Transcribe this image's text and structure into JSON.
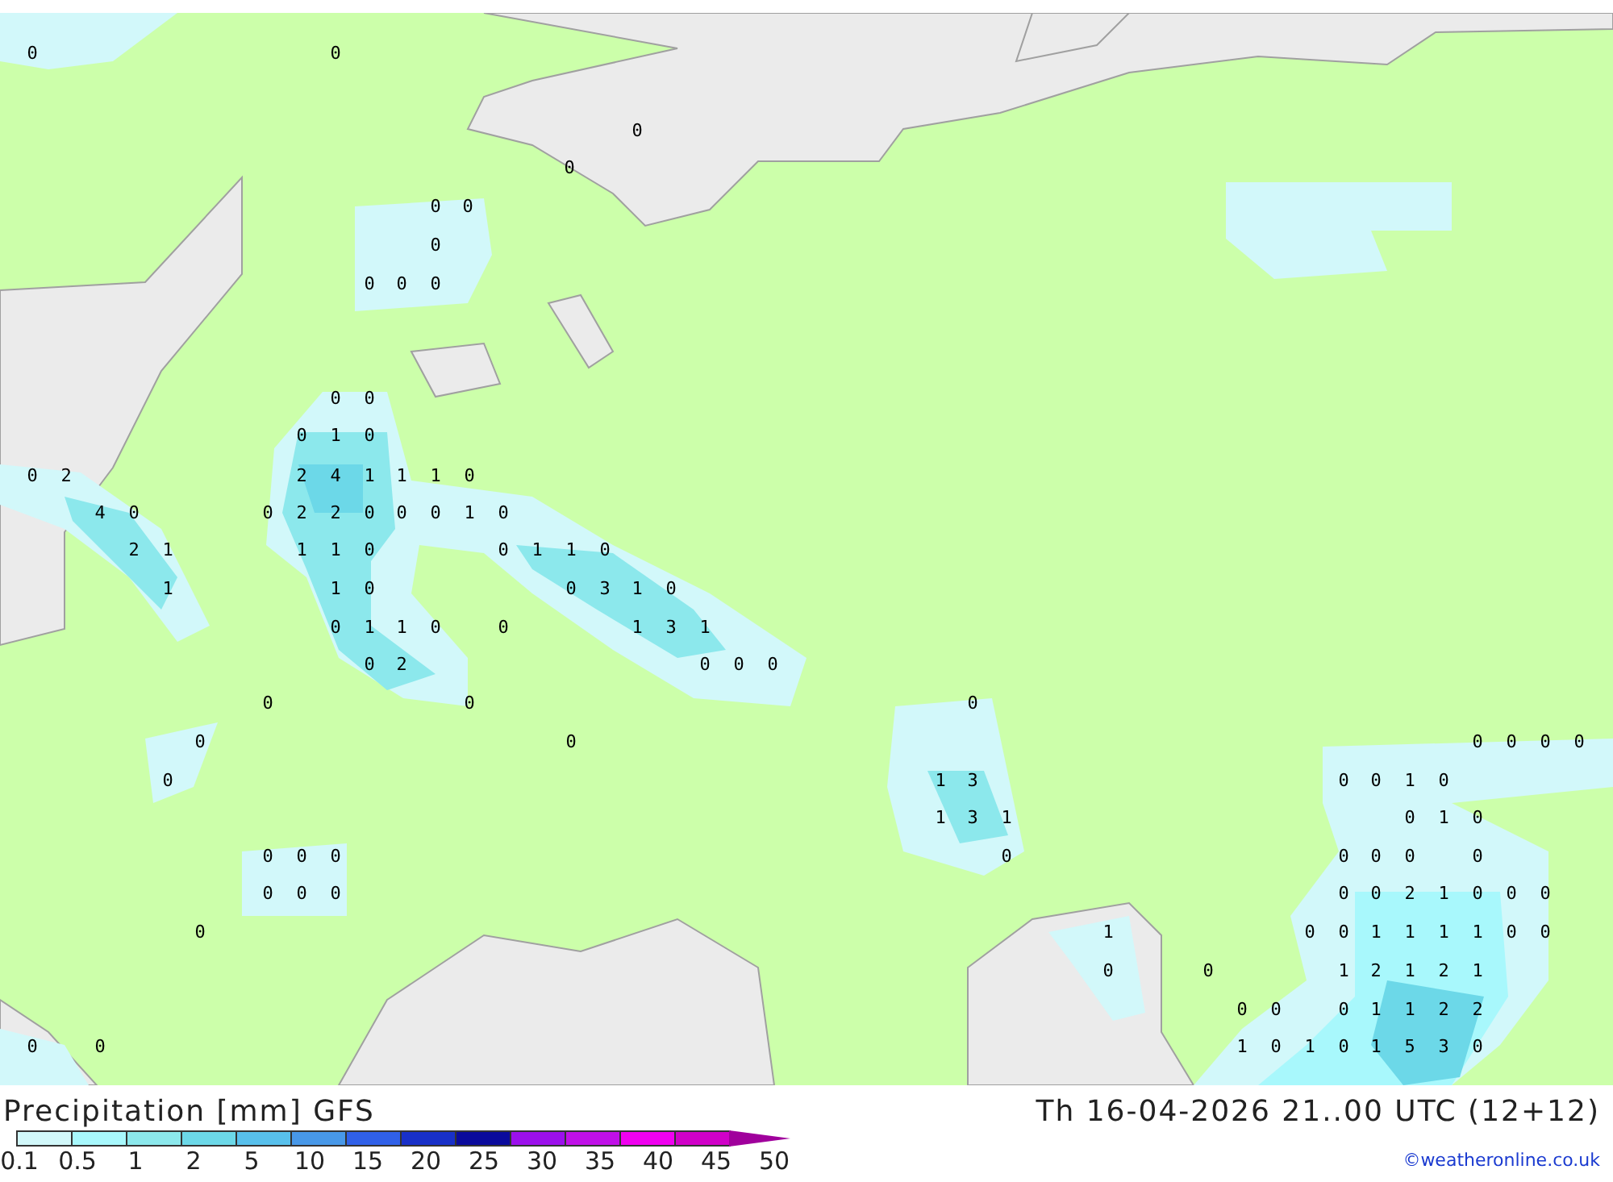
{
  "map": {
    "values": [
      "0",
      "0",
      "0",
      "0",
      "0",
      "0",
      "0",
      "0",
      "0",
      "0",
      "0",
      "0",
      "0",
      "1",
      "0",
      "0",
      "2",
      "2",
      "4",
      "1",
      "1",
      "1",
      "0",
      "4",
      "0",
      "0",
      "2",
      "2",
      "0",
      "0",
      "0",
      "1",
      "0",
      "2",
      "1",
      "1",
      "1",
      "0",
      "0",
      "1",
      "1",
      "0",
      "1",
      "1",
      "0",
      "0",
      "3",
      "1",
      "0",
      "0",
      "1",
      "1",
      "0",
      "0",
      "1",
      "3",
      "1",
      "0",
      "2",
      "0",
      "0",
      "0",
      "0",
      "0",
      "0",
      "0",
      "0",
      "0",
      "0",
      "0",
      "0",
      "0",
      "1",
      "3",
      "0",
      "0",
      "1",
      "0",
      "1",
      "3",
      "1",
      "0",
      "1",
      "0",
      "0",
      "0",
      "0",
      "0",
      "0",
      "0",
      "0",
      "0",
      "0",
      "0",
      "0",
      "0",
      "0",
      "2",
      "1",
      "0",
      "0",
      "0",
      "0",
      "1",
      "0",
      "0",
      "1",
      "1",
      "1",
      "1",
      "0",
      "0",
      "0",
      "0",
      "1",
      "2",
      "1",
      "2",
      "1",
      "0",
      "0",
      "0",
      "1",
      "1",
      "2",
      "2",
      "0",
      "0",
      "1",
      "0",
      "1",
      "0",
      "1",
      "5",
      "3",
      "0"
    ]
  },
  "legend": {
    "title": "Precipitation [mm] GFS",
    "valid_time": "Th 16-04-2026 21..00 UTC (12+12)",
    "bins": [
      {
        "color": "#d2f8fa"
      },
      {
        "color": "#a8f8fc"
      },
      {
        "color": "#8ce8ec"
      },
      {
        "color": "#6cd8e8"
      },
      {
        "color": "#58c0ec"
      },
      {
        "color": "#4898e8"
      },
      {
        "color": "#3060e8"
      },
      {
        "color": "#1830c8"
      },
      {
        "color": "#0a0a9c"
      },
      {
        "color": "#9c10ec"
      },
      {
        "color": "#c010e8"
      },
      {
        "color": "#f000f0"
      },
      {
        "color": "#d000c8"
      }
    ],
    "ticks": [
      "0.1",
      "0.5",
      "1",
      "2",
      "5",
      "10",
      "15",
      "20",
      "25",
      "30",
      "35",
      "40",
      "45",
      "50"
    ],
    "credit": "©weatheronline.co.uk"
  }
}
